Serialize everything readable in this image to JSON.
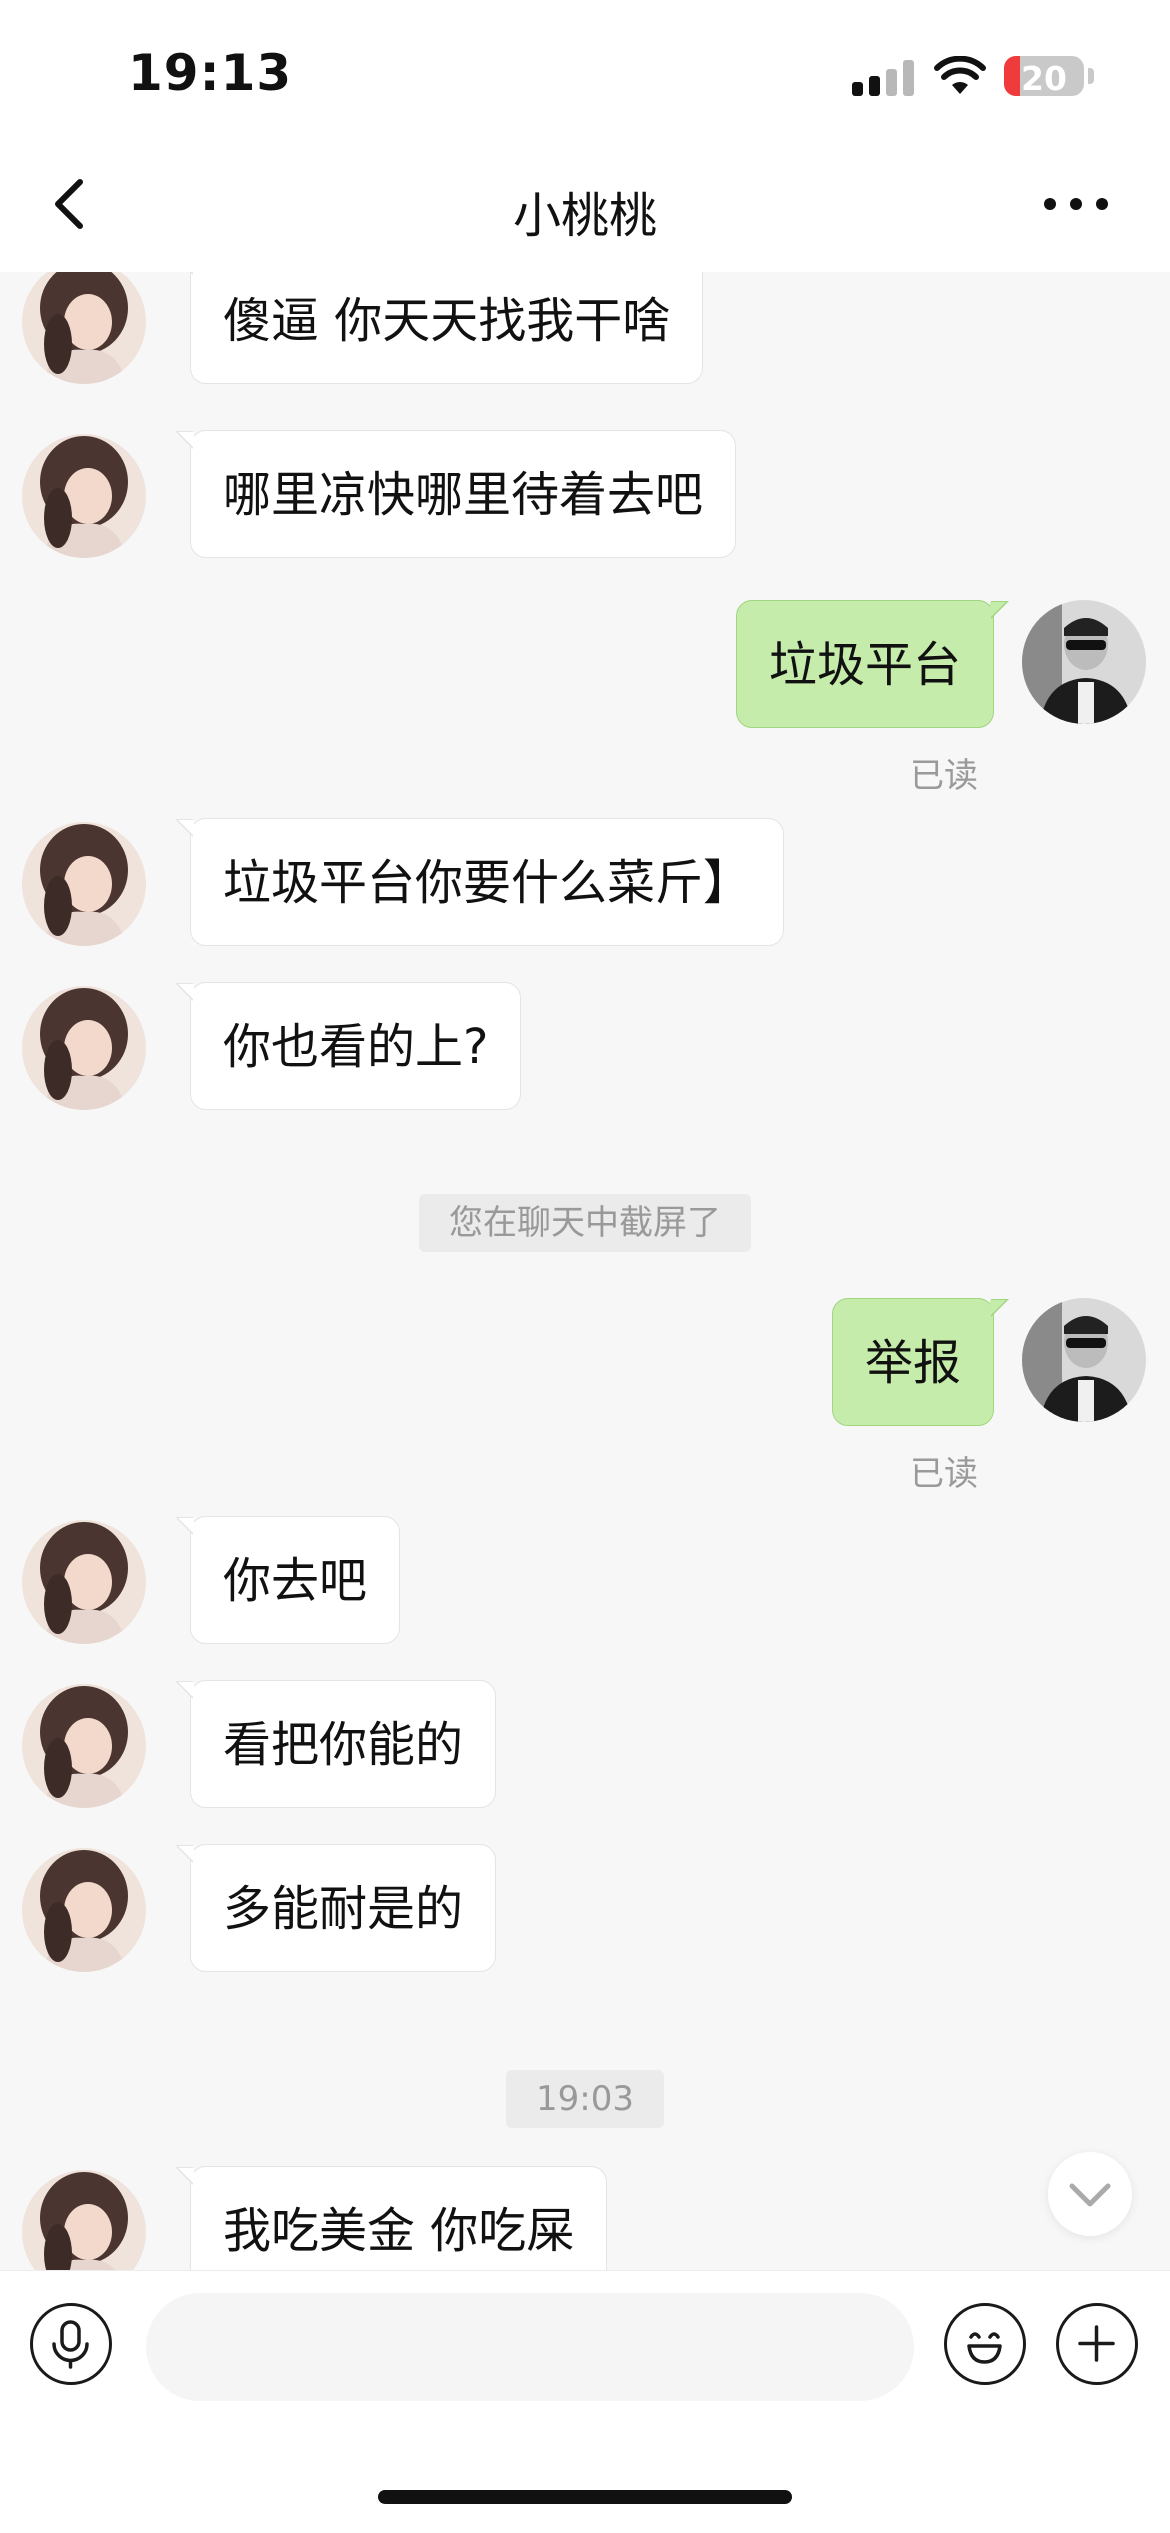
{
  "status_bar": {
    "time": "19:13",
    "battery": "20",
    "battery_level": 0.2
  },
  "header": {
    "title": "小桃桃",
    "back_icon": "chevron-left-icon",
    "more_icon": "more-horizontal-icon"
  },
  "messages": [
    {
      "sender": "contact",
      "text": "傻逼 你天天找我干啥"
    },
    {
      "sender": "contact",
      "text": "哪里凉快哪里待着去吧"
    },
    {
      "sender": "me",
      "text": "垃圾平台",
      "status": "已读"
    },
    {
      "sender": "contact",
      "text": "垃圾平台你要什么菜斤】"
    },
    {
      "sender": "contact",
      "text": "你也看的上?"
    },
    {
      "sender": "system",
      "text": "您在聊天中截屏了"
    },
    {
      "sender": "me",
      "text": "举报",
      "status": "已读"
    },
    {
      "sender": "contact",
      "text": "你去吧"
    },
    {
      "sender": "contact",
      "text": "看把你能的"
    },
    {
      "sender": "contact",
      "text": "多能耐是的"
    },
    {
      "sender": "time",
      "text": "19:03"
    },
    {
      "sender": "contact",
      "text": "我吃美金 你吃屎"
    }
  ],
  "input_bar": {
    "placeholder": "",
    "voice_icon": "microphone-icon",
    "emoji_icon": "emoji-icon",
    "plus_icon": "plus-icon"
  },
  "colors": {
    "outgoing_bubble": "#c5ecaa",
    "incoming_bubble": "#ffffff",
    "background": "#f7f7f7",
    "battery_low": "#ef3b3b"
  }
}
